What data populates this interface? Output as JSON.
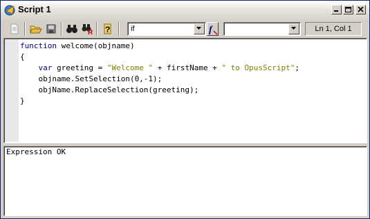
{
  "window": {
    "title": "Script 1"
  },
  "toolbar": {
    "buttons": [
      "new-document",
      "open-folder",
      "save",
      "find",
      "find-replace",
      "help"
    ],
    "keyword_combo": {
      "value": "if"
    },
    "function_combo": {
      "value": ""
    },
    "status": "Ln 1, Col 1"
  },
  "editor": {
    "lines": [
      [
        {
          "t": "function",
          "c": "kw"
        },
        {
          "t": " welcome(objname)",
          "c": ""
        }
      ],
      [
        {
          "t": "{",
          "c": ""
        }
      ],
      [
        {
          "t": "    ",
          "c": ""
        },
        {
          "t": "var",
          "c": "kw"
        },
        {
          "t": " greeting = ",
          "c": ""
        },
        {
          "t": "\"Welcome \"",
          "c": "str"
        },
        {
          "t": " + firstName + ",
          "c": ""
        },
        {
          "t": "\" to OpusScript\"",
          "c": "str"
        },
        {
          "t": ";",
          "c": ""
        }
      ],
      [
        {
          "t": "    objname.SetSelection(0,-1);",
          "c": ""
        }
      ],
      [
        {
          "t": "    objName.ReplaceSelection(greeting);",
          "c": ""
        }
      ],
      [
        {
          "t": "}",
          "c": ""
        }
      ]
    ]
  },
  "output": {
    "text": "Expression OK"
  }
}
